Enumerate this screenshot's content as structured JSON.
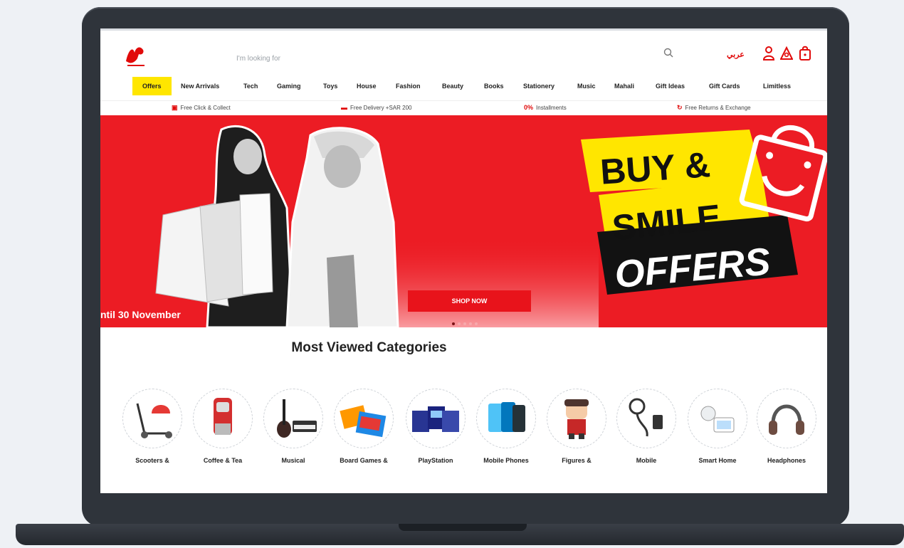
{
  "header": {
    "search_placeholder": "I'm looking for",
    "language_label": "عربي"
  },
  "nav": {
    "items": [
      "Offers",
      "New Arrivals",
      "Tech",
      "Gaming",
      "Toys",
      "House",
      "Fashion",
      "Beauty",
      "Books",
      "Stationery",
      "Music",
      "Mahali",
      "Gift Ideas",
      "Gift Cards",
      "Limitless"
    ]
  },
  "strip": {
    "items": [
      {
        "icon": "click-collect-icon",
        "text": "Free Click & Collect"
      },
      {
        "icon": "delivery-truck-icon",
        "text": "Free Delivery +SAR 200"
      },
      {
        "icon": "zero-percent-icon",
        "text": "Installments"
      },
      {
        "icon": "return-icon",
        "text": "Free Returns & Exchange"
      }
    ],
    "percent_label": "0%"
  },
  "banner": {
    "headline_1": "BUY &",
    "headline_2": "SMILE",
    "headline_3": "OFFERS",
    "date_text": "ntil 30 November",
    "button_label": "SHOP NOW",
    "slide_count": 5,
    "active_slide": 1
  },
  "categories": {
    "title": "Most Viewed Categories",
    "items": [
      "Scooters &",
      "Coffee & Tea",
      "Musical",
      "Board Games &",
      "PlayStation",
      "Mobile Phones",
      "Figures &",
      "Mobile",
      "Smart Home",
      "Headphones"
    ]
  },
  "colors": {
    "brand_red": "#ec1c24",
    "highlight_yellow": "#ffe600",
    "laptop_frame": "#2f343b"
  }
}
